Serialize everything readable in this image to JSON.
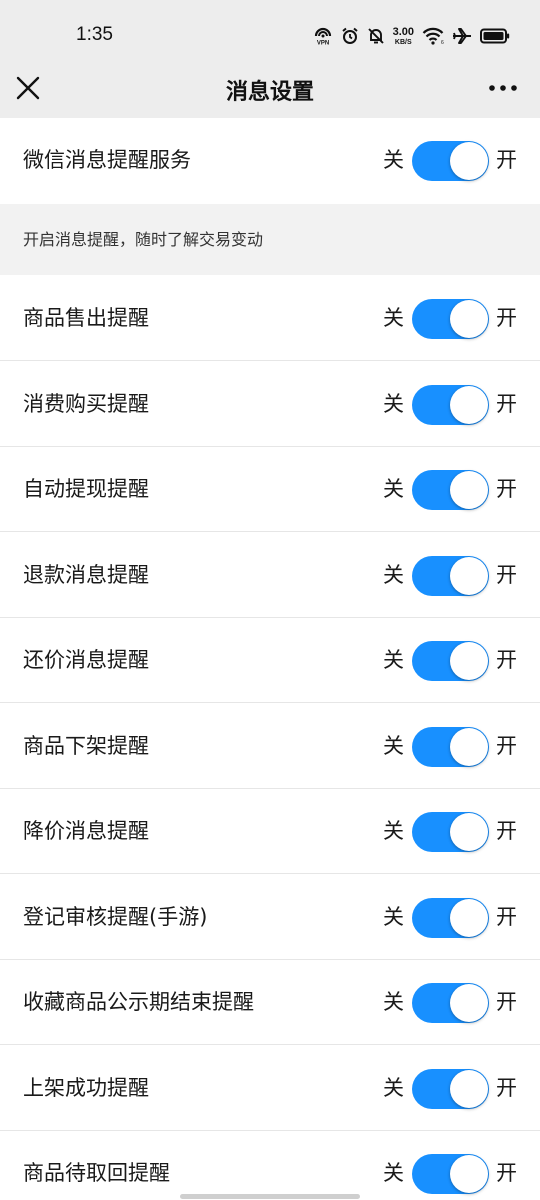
{
  "status_bar": {
    "time": "1:35",
    "net_speed_value": "3.00",
    "net_speed_unit": "KB/S",
    "icons": [
      "vpn-icon",
      "alarm-icon",
      "mute-bell-icon",
      "wifi-icon",
      "airplane-icon",
      "battery-icon"
    ]
  },
  "nav": {
    "title": "消息设置",
    "close_icon": "close-icon",
    "more_icon": "more-icon"
  },
  "toggle_labels": {
    "off": "关",
    "on": "开"
  },
  "main_setting": {
    "label": "微信消息提醒服务",
    "enabled": true
  },
  "section_note": "开启消息提醒，随时了解交易变动",
  "settings": [
    {
      "label": "商品售出提醒",
      "enabled": true
    },
    {
      "label": "消费购买提醒",
      "enabled": true
    },
    {
      "label": "自动提现提醒",
      "enabled": true
    },
    {
      "label": "退款消息提醒",
      "enabled": true
    },
    {
      "label": "还价消息提醒",
      "enabled": true
    },
    {
      "label": "商品下架提醒",
      "enabled": true
    },
    {
      "label": "降价消息提醒",
      "enabled": true
    },
    {
      "label": "登记审核提醒(手游)",
      "enabled": true
    },
    {
      "label": "收藏商品公示期结束提醒",
      "enabled": true
    },
    {
      "label": "上架成功提醒",
      "enabled": true
    },
    {
      "label": "商品待取回提醒",
      "enabled": true
    }
  ],
  "colors": {
    "accent": "#1890ff",
    "header_bg": "#ededed",
    "section_bg": "#f2f2f2",
    "divider": "#e6e6e6"
  }
}
